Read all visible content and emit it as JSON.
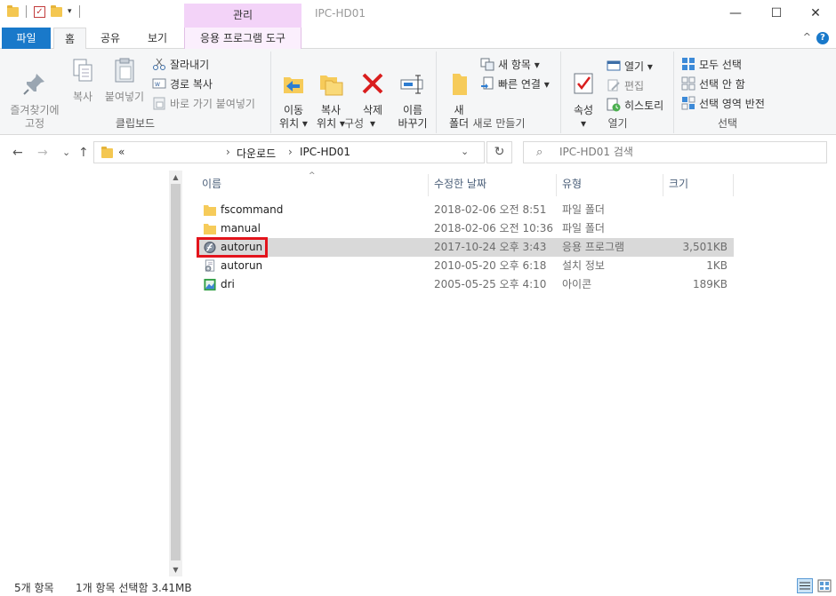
{
  "window": {
    "title": "IPC-HD01",
    "context_tab_header": "관리",
    "controls": {
      "minimize": "—",
      "maximize": "☐",
      "close": "✕"
    }
  },
  "ribbon_tabs": {
    "file": "파일",
    "home": "홈",
    "share": "공유",
    "view": "보기",
    "app_tools": "응용 프로그램 도구"
  },
  "ribbon": {
    "clipboard": {
      "label": "클립보드",
      "pin": "즐겨찾기에\n고정",
      "copy": "복사",
      "paste": "붙여넣기",
      "cut": "잘라내기",
      "copy_path": "경로 복사",
      "paste_shortcut": "바로 가기 붙여넣기"
    },
    "organize": {
      "label": "구성",
      "move": "이동\n위치 ▾",
      "copy_to": "복사\n위치 ▾",
      "delete": "삭제\n▾",
      "rename": "이름\n바꾸기"
    },
    "new": {
      "label": "새로 만들기",
      "new_folder": "새\n폴더",
      "new_item": "새 항목 ▾",
      "easy_access": "빠른 연결 ▾"
    },
    "open": {
      "label": "열기",
      "properties": "속성\n▾",
      "open": "열기 ▾",
      "edit": "편집",
      "history": "히스토리"
    },
    "select": {
      "label": "선택",
      "select_all": "모두 선택",
      "select_none": "선택 안 함",
      "invert": "선택 영역 반전"
    }
  },
  "navigation": {
    "back": "←",
    "forward": "→",
    "recent": "⌄",
    "up": "↑",
    "address_overflow": "«",
    "breadcrumb": [
      "다운로드",
      "IPC-HD01"
    ],
    "separator": "›",
    "search_placeholder": "IPC-HD01 검색"
  },
  "columns": {
    "name": "이름",
    "date": "수정한 날짜",
    "type": "유형",
    "size": "크기"
  },
  "files": [
    {
      "name": "fscommand",
      "date": "2018-02-06 오전 8:51",
      "type": "파일 폴더",
      "size": "",
      "icon": "folder-icon",
      "selected": false
    },
    {
      "name": "manual",
      "date": "2018-02-06 오전 10:36",
      "type": "파일 폴더",
      "size": "",
      "icon": "folder-icon",
      "selected": false
    },
    {
      "name": "autorun",
      "date": "2017-10-24 오후 3:43",
      "type": "응용 프로그램",
      "size": "3,501KB",
      "icon": "flash-app-icon",
      "selected": true
    },
    {
      "name": "autorun",
      "date": "2010-05-20 오후 6:18",
      "type": "설치 정보",
      "size": "1KB",
      "icon": "setup-info-icon",
      "selected": false
    },
    {
      "name": "dri",
      "date": "2005-05-25 오후 4:10",
      "type": "아이콘",
      "size": "189KB",
      "icon": "image-icon",
      "selected": false
    }
  ],
  "status": {
    "item_count": "5개 항목",
    "selection": "1개 항목 선택함 3.41MB"
  },
  "colors": {
    "accent": "#1979ca",
    "context_tab": "#f3d3f8",
    "selection": "#d9d9d9",
    "highlight_box": "#e3141c"
  }
}
